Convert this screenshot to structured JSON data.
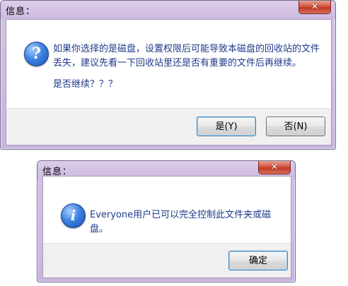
{
  "dialog1": {
    "title": "信息：",
    "close_label": "✕",
    "message": "如果你选择的是磁盘，设置权限后可能导致本磁盘的回收站的文件丢失，建议先看一下回收站里还是否有重要的文件后再继续。",
    "question": "是否继续？？？",
    "yes_label": "是(Y)",
    "no_label": "否(N)",
    "icon": "question-icon"
  },
  "dialog2": {
    "title": "信息：",
    "close_label": "✕",
    "message": "Everyone用户已可以完全控制此文件夹或磁盘。",
    "ok_label": "确定",
    "icon": "info-icon"
  }
}
